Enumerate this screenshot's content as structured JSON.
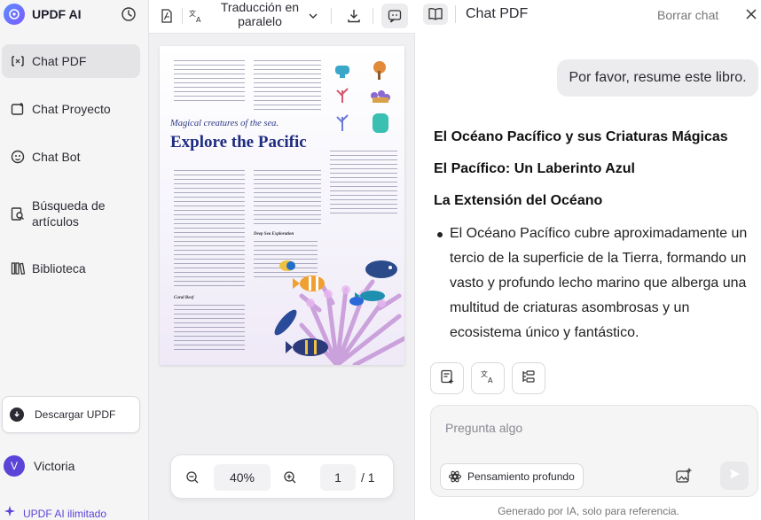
{
  "sidebar": {
    "brand": "UPDF AI",
    "items": [
      {
        "label": "Chat PDF",
        "active": true,
        "icon": "chat-pdf-icon"
      },
      {
        "label": "Chat Proyecto",
        "active": false,
        "icon": "chat-project-icon"
      },
      {
        "label": "Chat Bot",
        "active": false,
        "icon": "chat-bot-icon"
      },
      {
        "label": "Búsqueda de artículos",
        "active": false,
        "icon": "article-search-icon"
      },
      {
        "label": "Biblioteca",
        "active": false,
        "icon": "library-icon"
      }
    ],
    "download_label": "Descargar UPDF",
    "user": {
      "initial": "V",
      "name": "Victoria"
    },
    "unlimited_label": "UPDF AI ilimitado"
  },
  "viewer": {
    "translate_label": "Traducción en paralelo",
    "document": {
      "subtitle": "Magical creatures of the sea.",
      "title": "Explore the Pacific",
      "sections": [
        "Deep Sea Exploration",
        "Coral Reef"
      ]
    },
    "zoom": "40%",
    "page_current": "1",
    "page_total": "/ 1"
  },
  "chat": {
    "title": "Chat PDF",
    "clear_label": "Borrar chat",
    "user_message": "Por favor, resume este libro.",
    "headings": [
      "El Océano Pacífico y sus Criaturas Mágicas",
      "El Pacífico: Un Laberinto Azul",
      "La Extensión del Océano"
    ],
    "bullet": "El Océano Pacífico cubre aproximadamente un tercio de la superficie de la Tierra, formando un vasto y profundo lecho marino que alberga una multitud de criaturas asombrosas y un ecosistema único y fantástico.",
    "input_placeholder": "Pregunta algo",
    "deep_thinking_label": "Pensamiento profundo",
    "footer": "Generado por IA, solo para referencia."
  },
  "colors": {
    "accent": "#5b45d9",
    "brand_blue": "#5b8cff",
    "pdf_title": "#1f2c80"
  }
}
